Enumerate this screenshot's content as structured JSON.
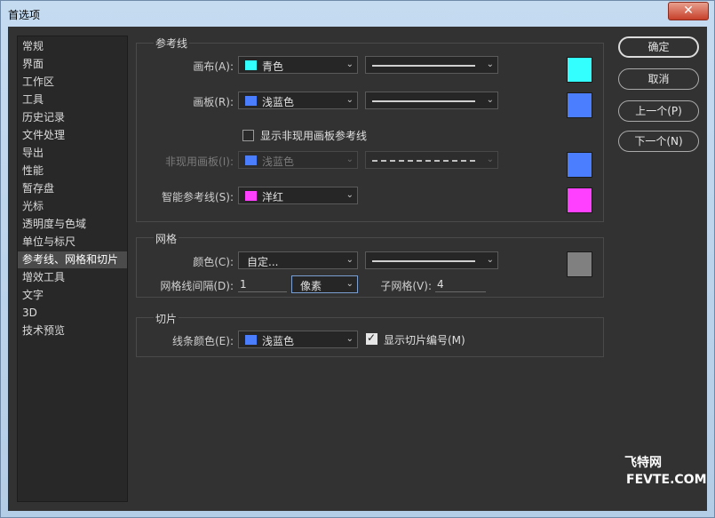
{
  "window": {
    "title": "首选项",
    "close_glyph": "✕"
  },
  "sidebar": {
    "items": [
      "常规",
      "界面",
      "工作区",
      "工具",
      "历史记录",
      "文件处理",
      "导出",
      "性能",
      "暂存盘",
      "光标",
      "透明度与色域",
      "单位与标尺",
      "参考线、网格和切片",
      "增效工具",
      "文字",
      "3D",
      "技术预览"
    ],
    "selected": "参考线、网格和切片"
  },
  "guides": {
    "title": "参考线",
    "canvas": {
      "label": "画布(A):",
      "color_name": "青色",
      "color": "#33ffff",
      "line": "solid"
    },
    "artboard": {
      "label": "画板(R):",
      "color_name": "浅蓝色",
      "color": "#4a7eff",
      "line": "solid"
    },
    "show_inactive": {
      "label": "显示非现用画板参考线",
      "checked": false
    },
    "inactive": {
      "label": "非现用画板(I):",
      "color_name": "浅蓝色",
      "color": "#4a7eff",
      "line": "dashed",
      "disabled": true
    },
    "smart": {
      "label": "智能参考线(S):",
      "color_name": "洋红",
      "color": "#ff40ff"
    }
  },
  "grid": {
    "title": "网格",
    "color": {
      "label": "颜色(C):",
      "value": "自定...",
      "swatch": "#808080",
      "line": "solid"
    },
    "gridline_every": {
      "label": "网格线间隔(D):",
      "value": "1",
      "unit": "像素"
    },
    "subdivisions": {
      "label": "子网格(V):",
      "value": "4"
    }
  },
  "slices": {
    "title": "切片",
    "line_color": {
      "label": "线条颜色(E):",
      "color_name": "浅蓝色",
      "color": "#4a7eff"
    },
    "show_numbers": {
      "label": "显示切片编号(M)",
      "checked": true
    }
  },
  "buttons": {
    "ok": "确定",
    "cancel": "取消",
    "prev": "上一个(P)",
    "next": "下一个(N)"
  },
  "watermark": {
    "line1": "飞特网",
    "line2": "FEVTE.COM"
  }
}
